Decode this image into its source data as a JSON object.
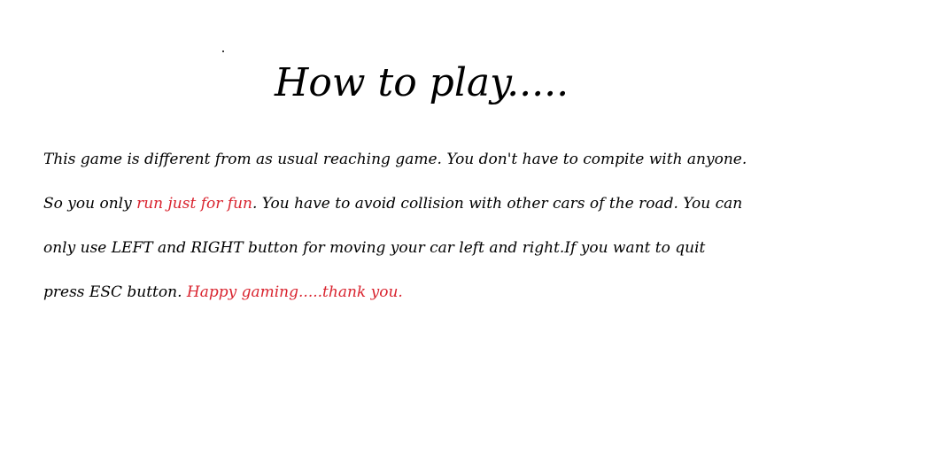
{
  "title": "How to play.....",
  "instructions": {
    "line1": "This game is different from as usual reaching game. You don't have to compite with anyone.",
    "line2_pre": "So you only ",
    "line2_highlight": "run just for fun",
    "line2_post": ". You have to avoid collision with other cars of the road. You can",
    "line3": "only use LEFT and RIGHT button for moving your car left and right.If  you want to quit",
    "line4_pre": "press ESC button. ",
    "line4_highlight": "Happy gaming.....thank you."
  },
  "colors": {
    "highlight": "#d9232e",
    "text": "#000000",
    "background": "#ffffff"
  }
}
